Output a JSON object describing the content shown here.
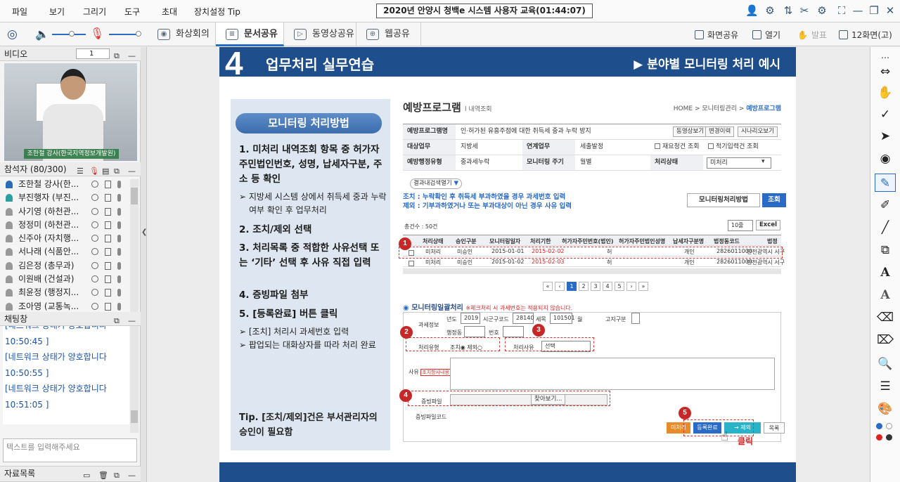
{
  "menu": [
    "파일",
    "보기",
    "그리기",
    "도구",
    "초대",
    "장치설정 Tip"
  ],
  "window_title": "2020년 안양시 청백e 시스템 사용자 교육(01:44:07)",
  "tabs": [
    {
      "label": "화상회의",
      "icon": "video-conference-icon"
    },
    {
      "label": "문서공유",
      "icon": "document-share-icon",
      "active": true
    },
    {
      "label": "동영상공유",
      "icon": "video-share-icon"
    },
    {
      "label": "웹공유",
      "icon": "web-share-icon"
    }
  ],
  "toolbar_right": {
    "screen_share": "화면공유",
    "open": "열기",
    "present": "발표",
    "layout": "12화면(고)"
  },
  "video_panel": {
    "title": "비디오",
    "index": "1",
    "caption": "조한철 강사(한국지역정보개발원)"
  },
  "participants": {
    "title": "참석자 (80/300)",
    "items": [
      {
        "name": "조한철 강사(한...",
        "role": "host"
      },
      {
        "name": "부진행자 (부진...",
        "role": "sub"
      },
      {
        "name": "사기영 (하천관...",
        "role": "user"
      },
      {
        "name": "정정미 (하천관...",
        "role": "user"
      },
      {
        "name": "신주아 (자치행...",
        "role": "user"
      },
      {
        "name": "서나래 (식품안...",
        "role": "user"
      },
      {
        "name": "김은정 (총무과)",
        "role": "user"
      },
      {
        "name": "이원배 (건설과)",
        "role": "user"
      },
      {
        "name": "최윤정 (행정지...",
        "role": "user"
      },
      {
        "name": "조아영 (교통녹...",
        "role": "user"
      }
    ]
  },
  "chat": {
    "title": "채팅창",
    "lines": [
      "[네트워크 상태가 양호합니다",
      "10:50:45 ]",
      "[네트워크 상태가 양호합니다",
      "10:50:55 ]",
      "[네트워크 상태가 양호합니다",
      "10:51:05 ]"
    ],
    "placeholder": "텍스트를 입력해주세요"
  },
  "files_title": "자료목록",
  "slide": {
    "number": "4",
    "title": "업무처리 실무연습",
    "tag": "▶ 분야별 모니터링 처리 예시",
    "method_title": "모니터링 처리방법",
    "steps": [
      "1.  미처리 내역조회 항목 중 허가자 주민법인번호, 성명, 납세자구분, 주소 등 확인",
      "2.  조치/제외 선택",
      "3.  처리목록 중 적합한 사유선택 또는 ‘기타’ 선택 후 사유 직접 입력",
      "4.  증빙파일 첨부",
      "5.  [등록완료] 버튼 클릭"
    ],
    "subs": [
      "➢  지방세 시스템 상에서 취득세 중과 누락여부 확인 후 업무처리",
      "➢  [조치] 처리시 과세번호 입력",
      "➢  팝업되는 대화상자를 따라 처리 완료"
    ],
    "tip": "Tip. [조치/제외]건은 부서관리자의 승인이 필요함"
  },
  "form": {
    "title": "예방프로그램",
    "title_sub": "l 내역조회",
    "breadcrumb": "HOME > 모니터링관리 >",
    "breadcrumb_current": "예방프로그램",
    "rows": [
      {
        "label": "예방프로그램명",
        "value": "인·허가된 유흥주점에 대한 취득세 중과 누락 방지"
      },
      {
        "label": "대상업무",
        "value": "지방세",
        "label2": "연계업무",
        "value2": "세출발정"
      },
      {
        "label": "예방행정유형",
        "value": "중과세누락",
        "label2": "모니터링 주기",
        "value2": "월별",
        "label3": "처리상태",
        "value3": "미처리"
      }
    ],
    "buttons_top": [
      "동영상보기",
      "변경이력",
      "시나리오보기"
    ],
    "checks": [
      "재요청건 조회",
      "적기입력건 조회"
    ],
    "expand": "결과내검색열기",
    "note1": "조치 : 누락확인 후 취득세 부과하였을 경우 과세번호 입력",
    "note2": "제외 : 기부과하였거나 또는 부과대상이 아닌 경우 사유 입력",
    "btn_monitor": "모니터링처리방법",
    "btn_search": "조회",
    "total": "총건수 : 50건",
    "page_size": "10줄",
    "excel": "Excel",
    "columns": [
      "처리상태",
      "승인구분",
      "모니터링일자",
      "처리기한",
      "허가자주민번호(법인)",
      "허가자주민법인성명",
      "납세자구분명",
      "법정동코드",
      "법정"
    ],
    "list_rows": [
      [
        "미처리",
        "미승인",
        "2015-01-01",
        "2015-02-02",
        "허",
        "개인",
        "2826011000",
        "인천광역시 서구"
      ],
      [
        "미처리",
        "미승인",
        "2015-01-02",
        "2015-02-03",
        "허",
        "개인",
        "2826011000",
        "인천광역시 서구"
      ]
    ],
    "pages": [
      "«",
      "‹",
      "1",
      "2",
      "3",
      "4",
      "5",
      "›",
      "»"
    ],
    "section2": "모니터링일괄처리",
    "section2_note": "※체크처리 시 과세번호는 적용되지 않습니다.",
    "fields": {
      "tax_info": "과세정보",
      "year_label": "년도",
      "year": "2019",
      "sigungu_label": "시군구코드",
      "sigungu": "28140",
      "semok_label": "세목",
      "semok": "101501",
      "gwa": "월",
      "gosi_label": "고지구분",
      "dong_label": "행정동",
      "bunho_label": "번호",
      "type_label": "처리유형",
      "type_value": "조치◉ 제외○",
      "reason_label": "처리사유",
      "reason_value": "선택",
      "reason_text_label": "사유",
      "reason_btn": "조치항사내용",
      "file_label": "증빙파일",
      "file_btn": "찾아보기...",
      "file_code": "증빙파일코드"
    },
    "bottom_buttons": [
      "미처리",
      "등록완료",
      "→ 제외",
      "목록"
    ],
    "click_label": "클릭",
    "badges": [
      "1",
      "2",
      "3",
      "4",
      "5"
    ]
  },
  "colors": {
    "accent": "#2a6bc8",
    "slide_header": "#1f4e8c",
    "highlight": "#d33"
  }
}
